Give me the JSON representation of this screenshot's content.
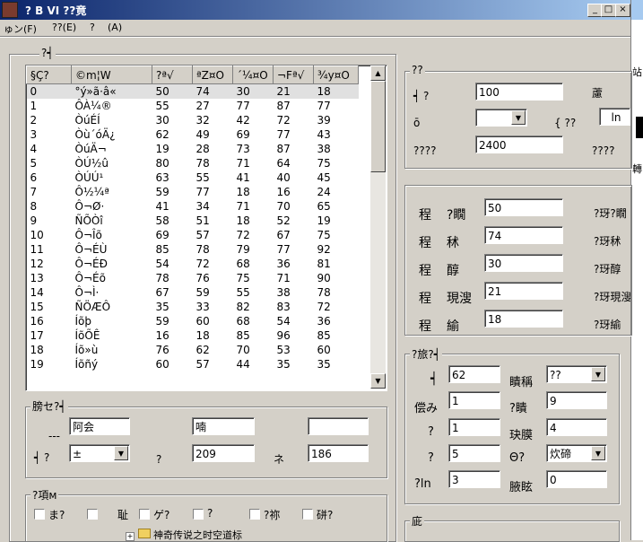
{
  "window": {
    "title": "? B VI        ??竟",
    "minimize": "_",
    "maximize": "□",
    "close": "×"
  },
  "menu": [
    "ゅン(F)",
    "??(E)",
    "?",
    "(A)"
  ],
  "list_group": {
    "legend": "?┥"
  },
  "table": {
    "columns": [
      "§Ç?",
      "©m¦W",
      "?ª√",
      "ªZ¤O",
      "´¼¤O",
      "¬Fª√",
      "¾y¤O"
    ],
    "rows": [
      [
        "0",
        "°ý»ã·â«",
        "50",
        "74",
        "30",
        "21",
        "18"
      ],
      [
        "1",
        "ÔÀ¼®",
        "55",
        "27",
        "77",
        "87",
        "77"
      ],
      [
        "2",
        "ÒúÉÍ",
        "30",
        "32",
        "42",
        "72",
        "39"
      ],
      [
        "3",
        "Òù´óÄ¿",
        "62",
        "49",
        "69",
        "77",
        "43"
      ],
      [
        "4",
        "ÒúÄ¬",
        "19",
        "28",
        "73",
        "87",
        "38"
      ],
      [
        "5",
        "ÒÚ½û",
        "80",
        "78",
        "71",
        "64",
        "75"
      ],
      [
        "6",
        "ÒÚÚ¹",
        "63",
        "55",
        "41",
        "40",
        "45"
      ],
      [
        "7",
        "Ô½¼ª",
        "59",
        "77",
        "18",
        "16",
        "24"
      ],
      [
        "8",
        "Ô¬Ø·",
        "41",
        "34",
        "71",
        "70",
        "65"
      ],
      [
        "9",
        "ÑÕÒî",
        "58",
        "51",
        "18",
        "52",
        "19"
      ],
      [
        "10",
        "Ô¬Îõ",
        "69",
        "57",
        "72",
        "67",
        "75"
      ],
      [
        "11",
        "Ô¬ÉÙ",
        "85",
        "78",
        "79",
        "77",
        "92"
      ],
      [
        "12",
        "Ô¬ÉÐ",
        "54",
        "72",
        "68",
        "36",
        "81"
      ],
      [
        "13",
        "Ô¬Éõ",
        "78",
        "76",
        "75",
        "71",
        "90"
      ],
      [
        "14",
        "Ô¬Ì·",
        "67",
        "59",
        "55",
        "38",
        "78"
      ],
      [
        "15",
        "ÑÖÆÔ",
        "35",
        "33",
        "82",
        "83",
        "72"
      ],
      [
        "16",
        "Íõþ",
        "59",
        "60",
        "68",
        "54",
        "36"
      ],
      [
        "17",
        "ÍõÕÊ",
        "16",
        "18",
        "85",
        "96",
        "85"
      ],
      [
        "18",
        "Íõ»ù",
        "76",
        "62",
        "70",
        "53",
        "60"
      ],
      [
        "19",
        "Íõñý",
        "60",
        "57",
        "44",
        "35",
        "35"
      ]
    ]
  },
  "bottom_left_group": {
    "legend": "膀セ?┥",
    "row1_dashes": "---",
    "name_value": "阿会",
    "mid_value": "喃",
    "right_value": "",
    "row2_label": "┥ ?",
    "dropdown_value": "±",
    "q_label": "?",
    "num_value": "209",
    "ne_label": "ネ",
    "num2_value": "186"
  },
  "flags_group": {
    "legend": "?項м",
    "items": [
      "ま?",
      "",
      "耻",
      "ゲ?",
      "?",
      "?祢",
      "硑?"
    ]
  },
  "top_right_group": {
    "legend": "??",
    "row1_label": "┥ ?",
    "row1_value": "100",
    "row1_right": "藘",
    "row2_label": "ō",
    "row2_dropdown": "",
    "row2_mid": "{ ??",
    "row2_box": "ln",
    "row3_label": "????",
    "row3_value": "2400",
    "row3_right": "????"
  },
  "stats_group": {
    "rows": [
      {
        "c1": "程",
        "c2": "?瞯",
        "value": "50",
        "right": "?玡?瞯"
      },
      {
        "c1": "程",
        "c2": "秫",
        "value": "74",
        "right": "?玡秫"
      },
      {
        "c1": "程",
        "c2": "醇",
        "value": "30",
        "right": "?玡醇"
      },
      {
        "c1": "程",
        "c2": "現溲",
        "value": "21",
        "right": "?玡現溲"
      },
      {
        "c1": "程",
        "c2": "緰",
        "value": "18",
        "right": "?玡緰"
      }
    ]
  },
  "misc_group": {
    "legend": "?旅?┥",
    "left": [
      {
        "label": "┥",
        "value": "62"
      },
      {
        "label": "偿み",
        "value": "1"
      },
      {
        "label": "?",
        "value": "1"
      },
      {
        "label": "?",
        "value": "5"
      },
      {
        "label": "?ln",
        "value": "3"
      }
    ],
    "right": [
      {
        "label": "瞶稱",
        "value": "??",
        "dropdown": true
      },
      {
        "label": "?瞶",
        "value": "9",
        "dropdown": false
      },
      {
        "label": "玦膜",
        "value": "4",
        "dropdown": false
      },
      {
        "label": "Θ?",
        "value": "炊碲",
        "dropdown": true
      },
      {
        "label": "腋眩",
        "value": "0",
        "dropdown": false
      }
    ]
  },
  "bottom_right_group": {
    "legend": "庛"
  },
  "background_window": {
    "tree_item": "神奇传说之时空道标",
    "side_labels": [
      "站",
      "轉"
    ]
  }
}
